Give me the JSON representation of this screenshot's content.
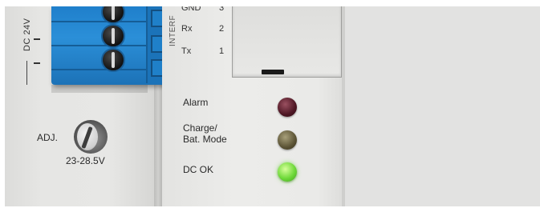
{
  "device": {
    "left_module": {
      "vertical_label": "DC 24V",
      "adjust_label": "ADJ.",
      "adjust_range": "23-28.5V"
    },
    "interface": {
      "vertical_label": "INTERF",
      "pins": [
        {
          "name": "GND",
          "number": "3"
        },
        {
          "name": "Rx",
          "number": "2"
        },
        {
          "name": "Tx",
          "number": "1"
        }
      ]
    },
    "indicators": [
      {
        "label": "Alarm",
        "state": "off",
        "color": "#4e1724"
      },
      {
        "label": "Charge/\nBat. Mode",
        "state": "off",
        "color": "#5b5335"
      },
      {
        "label": "DC OK",
        "state": "on",
        "color": "#6fd93a"
      }
    ],
    "colors": {
      "terminal_block": "#1f7fcb",
      "housing": "#e9e9e8",
      "background": "#e2e2e1"
    }
  }
}
